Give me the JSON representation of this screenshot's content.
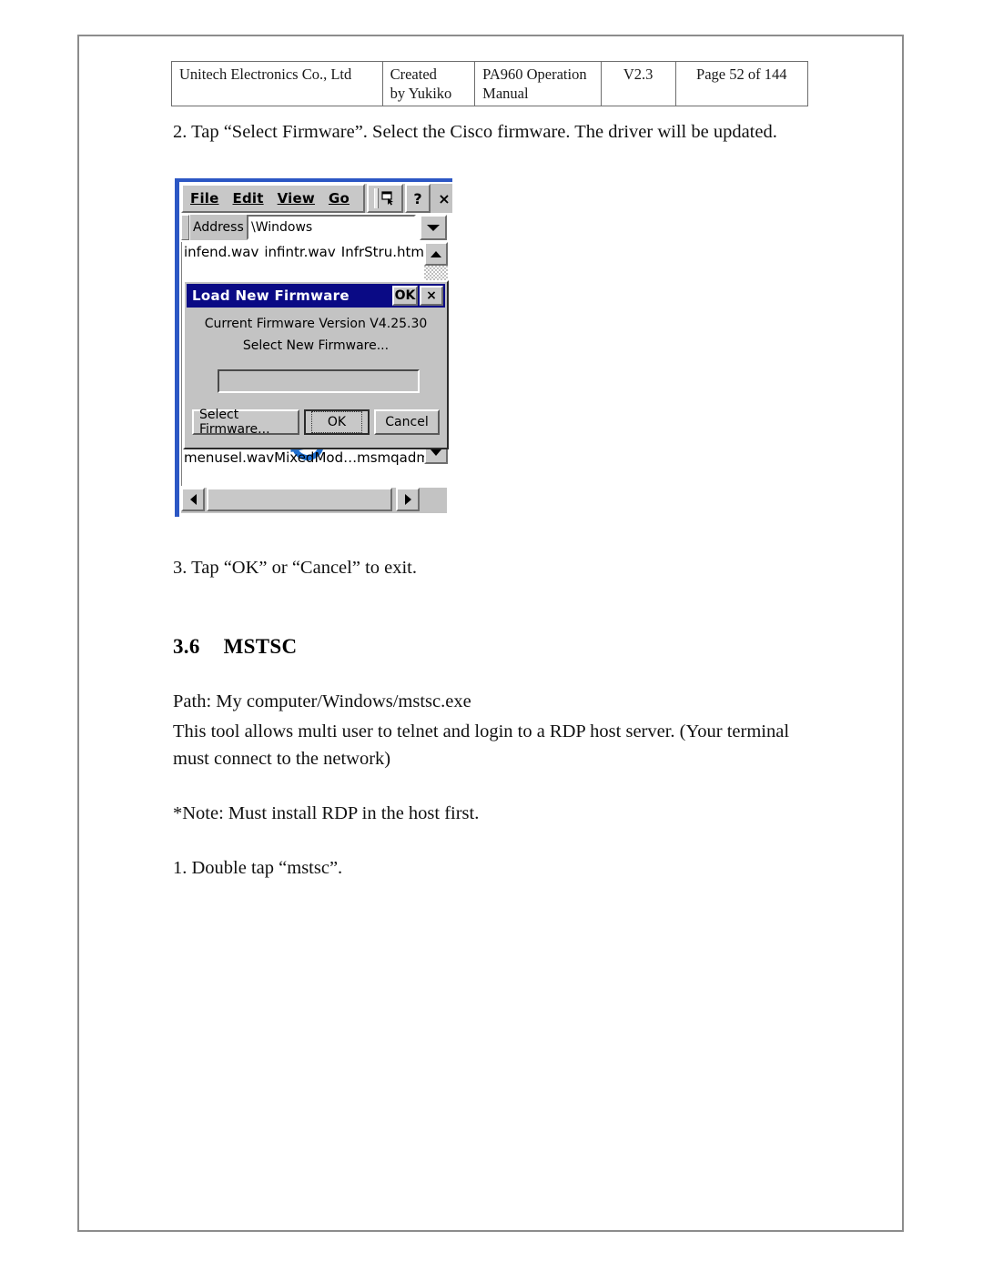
{
  "header": {
    "company": "Unitech Electronics Co., Ltd",
    "created": "Created by Yukiko",
    "manual": "PA960 Operation Manual",
    "version": "V2.3",
    "page": "Page 52 of 144"
  },
  "body": {
    "step2": "2. Tap “Select Firmware”. Select the Cisco firmware. The driver will be updated.",
    "step3": "3. Tap “OK” or “Cancel” to exit.",
    "section_number": "3.6",
    "section_title": "MSTSC",
    "path": "Path: My computer/Windows/mstsc.exe",
    "description_line1": "This tool allows multi user to telnet and login to a RDP host server. (Your terminal",
    "description_line2": "must connect to the network)",
    "note": "*Note: Must install RDP in the host first.",
    "step1_mstsc": "1. Double tap “mstsc”."
  },
  "screenshot": {
    "menu": {
      "file": "File",
      "edit": "Edit",
      "view": "View",
      "go": "Go",
      "help_label": "?",
      "close_label": "×"
    },
    "address": {
      "label": "Address",
      "value": "\\Windows"
    },
    "files_top": [
      "infend.wav",
      "infintr.wav",
      "InfrStru.htm"
    ],
    "files_bottom": [
      "menusel.wav",
      "MixedMod…",
      "msmqadm…."
    ],
    "dialog": {
      "title": "Load New Firmware",
      "ok_title_btn": "OK",
      "close_title_btn": "×",
      "line1": "Current Firmware Version V4.25.30",
      "line2": "Select New Firmware...",
      "input_value": "",
      "select_firmware_btn": "Select Firmware...",
      "ok_btn": "OK",
      "cancel_btn": "Cancel"
    }
  },
  "colors": {
    "dialog_titlebar": "#0a0a85",
    "chrome_face": "#c3c3c3",
    "device_edge": "#2c57c4"
  }
}
